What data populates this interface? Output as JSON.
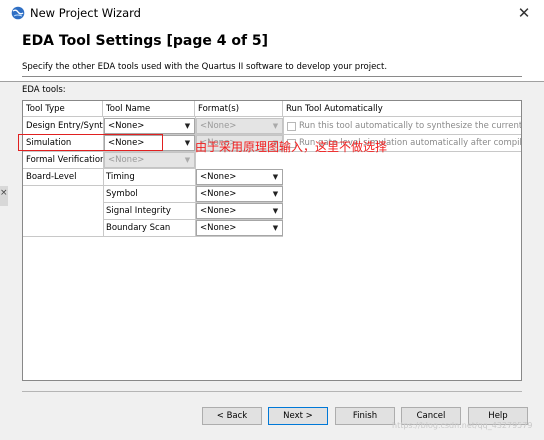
{
  "window": {
    "title": "New Project Wizard",
    "close_symbol": "✕"
  },
  "header": {
    "title": "EDA Tool Settings [page 4 of 5]",
    "description": "Specify the other EDA tools used with the Quartus II software to develop your project."
  },
  "eda_tools_label": "EDA tools:",
  "table": {
    "headers": [
      "Tool Type",
      "Tool Name",
      "Format(s)",
      "Run Tool Automatically"
    ],
    "rows": [
      {
        "tool_type": "Design Entry/Synt...",
        "tool_name": "<None>",
        "format": "<None>",
        "run_text": "Run this tool automatically to synthesize the current design"
      },
      {
        "tool_type": "Simulation",
        "tool_name": "<None>",
        "format": "<None>",
        "run_text": "Run gate-level simulation automatically after compilation"
      },
      {
        "tool_type": "Formal Verification",
        "tool_name": "<None>"
      },
      {
        "tool_type": "Board-Level",
        "tool_name": "Timing",
        "format": "<None>"
      },
      {
        "tool_type": "",
        "tool_name": "Symbol",
        "format": "<None>"
      },
      {
        "tool_type": "",
        "tool_name": "Signal Integrity",
        "format": "<None>"
      },
      {
        "tool_type": "",
        "tool_name": "Boundary Scan",
        "format": "<None>"
      }
    ]
  },
  "annotation": "由于采用原理图输入，这里不做选择",
  "buttons": {
    "back": "< Back",
    "next": "Next >",
    "finish": "Finish",
    "cancel": "Cancel",
    "help": "Help"
  },
  "watermark": "https://blog.csdn.net/qq_43279579",
  "colors": {
    "annotation": "#f22020",
    "default_button_border": "#0078d7"
  },
  "icons": {
    "app": "quartus-globe-icon",
    "dropdown": "chevron-down-icon",
    "close": "close-icon"
  },
  "glyphs": {
    "dropdown_arrow": "▼",
    "fragment": "×"
  }
}
